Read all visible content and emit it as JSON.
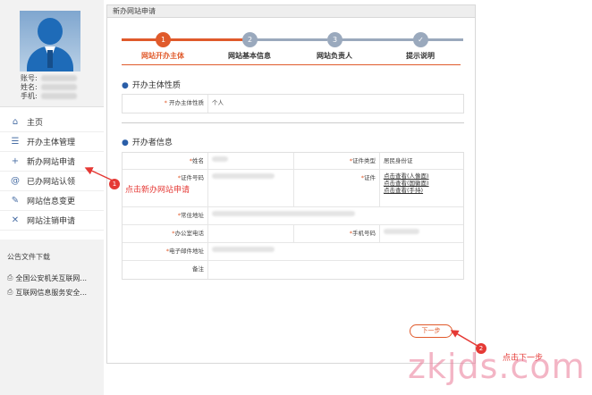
{
  "profile": {
    "account_label": "账号:",
    "name_label": "姓名:",
    "phone_label": "手机:"
  },
  "nav": [
    {
      "label": "主页",
      "icon": "home-icon",
      "glyph": "⌂"
    },
    {
      "label": "开办主体管理",
      "icon": "list-icon",
      "glyph": "☰"
    },
    {
      "label": "新办网站申请",
      "icon": "plus-icon",
      "glyph": "+"
    },
    {
      "label": "已办网站认领",
      "icon": "at-icon",
      "glyph": "@"
    },
    {
      "label": "网站信息变更",
      "icon": "edit-icon",
      "glyph": "✎"
    },
    {
      "label": "网站注销申请",
      "icon": "close-icon",
      "glyph": "✕"
    }
  ],
  "downloads": {
    "title": "公告文件下载",
    "items": [
      "全国公安机关互联网...",
      "互联网信息服务安全..."
    ]
  },
  "main": {
    "header": "新办网站申请",
    "steps": [
      {
        "num": "1",
        "label": "网站开办主体"
      },
      {
        "num": "2",
        "label": "网站基本信息"
      },
      {
        "num": "3",
        "label": "网站负责人"
      },
      {
        "num": "✓",
        "label": "提示说明"
      }
    ],
    "section1": {
      "title": "开办主体性质",
      "label": "开办主体性质",
      "value": "个人"
    },
    "section2": {
      "title": "开办者信息",
      "name_label": "姓名",
      "id_type_label": "证件类型",
      "id_type_value": "居民身份证",
      "id_number_label": "证件号码",
      "cert_label": "证件",
      "cert_links": [
        "点击查看(人像面)",
        "点击查看(国徽面)",
        "点击查看(手持)"
      ],
      "address_label": "常住地址",
      "office_phone_label": "办公室电话",
      "mobile_label": "手机号码",
      "email_label": "电子邮件地址",
      "remark_label": "备注"
    },
    "next_button": "下一步"
  },
  "annotations": {
    "marker1": "1",
    "text1": "点击新办网站申请",
    "marker2": "2",
    "text2": "点击下一步"
  },
  "watermark": "zkjds.com",
  "colors": {
    "accent": "#e05a2b",
    "step_inactive": "#9aa9bd",
    "annotation_red": "#e53935",
    "nav_icon": "#4a6fa5"
  }
}
